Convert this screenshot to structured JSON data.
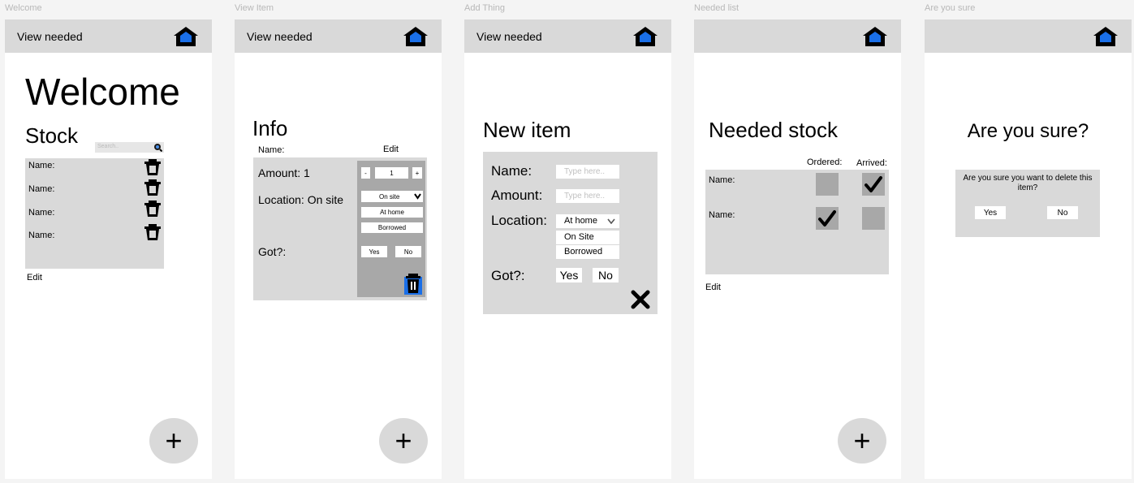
{
  "frames": {
    "welcome": {
      "label": "Welcome",
      "view_needed": "View needed",
      "title": "Welcome",
      "subtitle": "Stock",
      "search_placeholder": "Search..",
      "items": [
        "Name:",
        "Name:",
        "Name:",
        "Name:"
      ],
      "edit": "Edit",
      "add": "+"
    },
    "view_item": {
      "label": "View Item",
      "view_needed": "View needed",
      "title": "Info",
      "name": "Name:",
      "edit": "Edit",
      "amount": "Amount: 1",
      "location": "Location: On site",
      "got": "Got?:",
      "stepper_minus": "-",
      "stepper_value": "1",
      "stepper_plus": "+",
      "select_value": "On site",
      "opt_home": "At home",
      "opt_borrowed": "Borrowed",
      "yes": "Yes",
      "no": "No",
      "add": "+"
    },
    "add_thing": {
      "label": "Add Thing",
      "view_needed": "View needed",
      "title": "New item",
      "name": "Name:",
      "amount": "Amount:",
      "location": "Location:",
      "got": "Got?:",
      "name_placeholder": "Type here..",
      "amount_placeholder": "Type here..",
      "select_value": "At home",
      "opt_onsite": "On Site",
      "opt_borrowed": "Borrowed",
      "yes": "Yes",
      "no": "No"
    },
    "needed_list": {
      "label": "Needed list",
      "title": "Needed stock",
      "col_ordered": "Ordered:",
      "col_arrived": "Arrived:",
      "rows": [
        {
          "name": "Name:",
          "ordered": false,
          "arrived": true
        },
        {
          "name": "Name:",
          "ordered": true,
          "arrived": false
        }
      ],
      "edit": "Edit",
      "add": "+"
    },
    "are_you_sure": {
      "label": "Are you sure",
      "title": "Are you sure?",
      "message": "Are you sure you want to delete this item?",
      "yes": "Yes",
      "no": "No"
    }
  },
  "colors": {
    "panel": "#d9d9d9",
    "checkbox": "#a8a8a8",
    "home_accent": "#1a6fe8"
  }
}
